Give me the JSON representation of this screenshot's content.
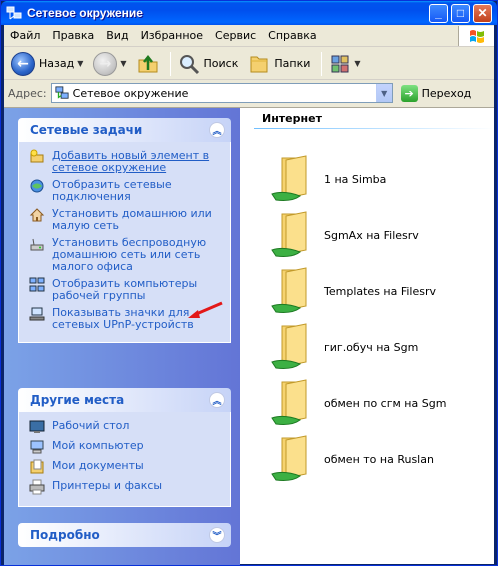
{
  "window": {
    "title": "Сетевое окружение"
  },
  "menu": [
    "Файл",
    "Правка",
    "Вид",
    "Избранное",
    "Сервис",
    "Справка"
  ],
  "toolbar": {
    "back": "Назад",
    "search": "Поиск",
    "folders": "Папки"
  },
  "address": {
    "label": "Адрес:",
    "value": "Сетевое окружение",
    "go": "Переход"
  },
  "network_tasks": {
    "title": "Сетевые задачи",
    "items": [
      {
        "label": "Добавить новый элемент в сетевое окружение",
        "icon": "add-network-place-icon"
      },
      {
        "label": "Отобразить сетевые подключения",
        "icon": "network-connections-icon"
      },
      {
        "label": "Установить домашнюю или малую сеть",
        "icon": "home-network-icon"
      },
      {
        "label": "Установить беспроводную домашнюю сеть или сеть малого офиса",
        "icon": "wireless-network-icon"
      },
      {
        "label": "Отобразить компьютеры рабочей группы",
        "icon": "workgroup-computers-icon"
      },
      {
        "label": "Показывать значки для сетевых UPnP-устройств",
        "icon": "upnp-icon"
      }
    ]
  },
  "other_places": {
    "title": "Другие места",
    "items": [
      {
        "label": "Рабочий стол",
        "icon": "desktop-icon"
      },
      {
        "label": "Мой компьютер",
        "icon": "my-computer-icon"
      },
      {
        "label": "Мои документы",
        "icon": "my-documents-icon"
      },
      {
        "label": "Принтеры и факсы",
        "icon": "printers-icon"
      }
    ]
  },
  "details": {
    "title": "Подробно"
  },
  "group": {
    "title": "Интернет"
  },
  "shares": [
    "1 на Simba",
    "SgmAx на Filesrv",
    "Templates на Filesrv",
    "гиг.обуч на Sgm",
    "обмен по сгм на Sgm",
    "обмен то на Ruslan"
  ],
  "colors": {
    "accent": "#215dc6",
    "annotation_arrow": "#e31818"
  }
}
